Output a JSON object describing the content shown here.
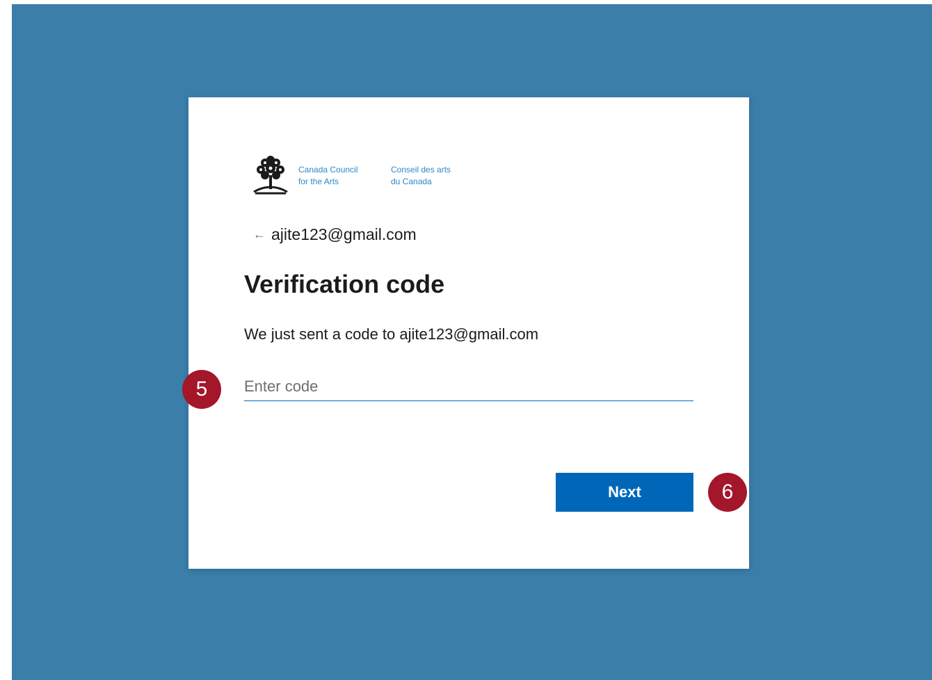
{
  "logo": {
    "icon": "tree-icon",
    "en_line1": "Canada Council",
    "en_line2": "for the Arts",
    "fr_line1": "Conseil des arts",
    "fr_line2": "du Canada"
  },
  "back": {
    "icon": "back-arrow-icon",
    "arrow_glyph": "←",
    "email": "ajite123@gmail.com"
  },
  "title": "Verification code",
  "description": "We just sent a code to ajite123@gmail.com",
  "code_input": {
    "placeholder": "Enter code",
    "value": ""
  },
  "next_label": "Next",
  "badges": {
    "step_5": "5",
    "step_6": "6"
  },
  "colors": {
    "backdrop": "#3b7eaa",
    "accent": "#0067b8",
    "badge": "#a4162a",
    "logo_text": "#2b88c8"
  }
}
